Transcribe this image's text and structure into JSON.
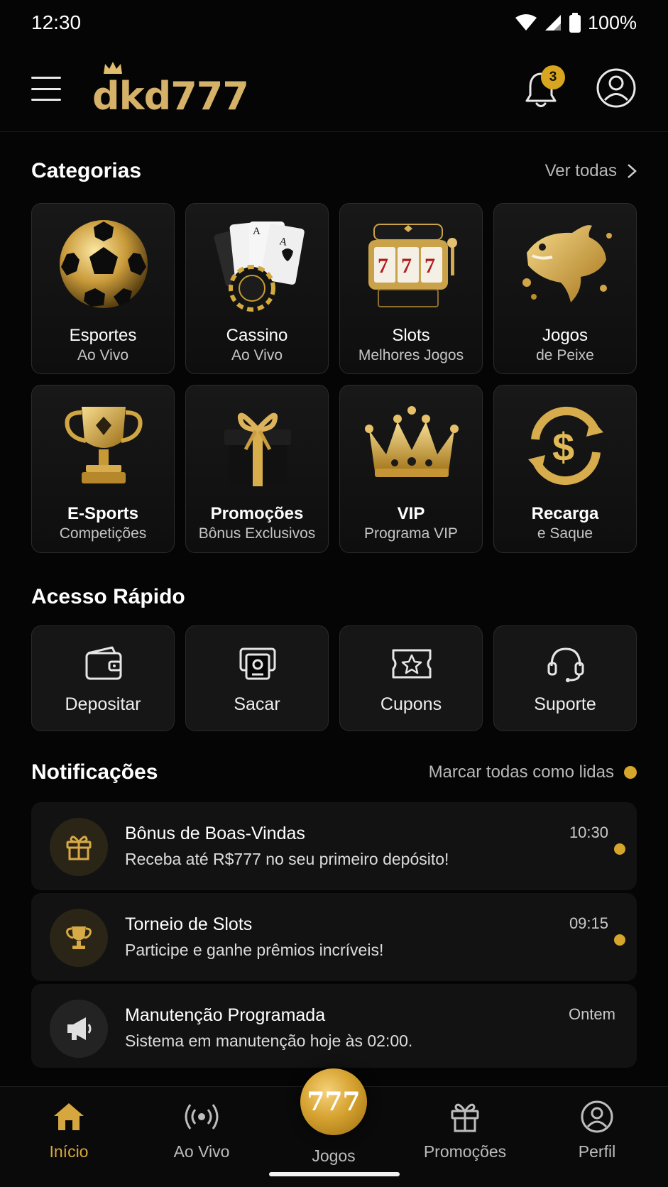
{
  "status_bar": {
    "time": "12:30",
    "battery": "100%"
  },
  "header": {
    "logo": "dkd777",
    "notification_count": "3"
  },
  "categories": {
    "title": "Categorias",
    "action": "Ver todas",
    "items": [
      {
        "title": "Esportes",
        "subtitle": "Ao Vivo",
        "icon": "soccer-ball-icon"
      },
      {
        "title": "Cassino",
        "subtitle": "Ao Vivo",
        "icon": "playing-cards-icon"
      },
      {
        "title": "Slots",
        "subtitle": "Melhores Jogos",
        "icon": "slot-machine-icon"
      },
      {
        "title": "Jogos",
        "subtitle": "de Peixe",
        "icon": "golden-fish-icon"
      },
      {
        "title": "E-Sports",
        "subtitle": "Competições",
        "icon": "trophy-icon"
      },
      {
        "title": "Promoções",
        "subtitle": "Bônus Exclusivos",
        "icon": "gift-box-icon"
      },
      {
        "title": "VIP",
        "subtitle": "Programa VIP",
        "icon": "crown-icon"
      },
      {
        "title": "Recarga",
        "subtitle": "e Saque",
        "icon": "dollar-exchange-icon"
      }
    ]
  },
  "quick_access": {
    "title": "Acesso Rápido",
    "items": [
      {
        "label": "Depositar",
        "icon": "wallet-icon"
      },
      {
        "label": "Sacar",
        "icon": "cash-withdraw-icon"
      },
      {
        "label": "Cupons",
        "icon": "coupon-icon"
      },
      {
        "label": "Suporte",
        "icon": "headset-icon"
      }
    ]
  },
  "notifications": {
    "title": "Notificações",
    "action": "Marcar todas como lidas",
    "items": [
      {
        "title": "Bônus de Boas-Vindas",
        "message": "Receba até R$777 no seu primeiro depósito!",
        "time": "10:30",
        "icon": "gift-icon",
        "unread": true
      },
      {
        "title": "Torneio de Slots",
        "message": "Participe e ganhe prêmios incríveis!",
        "time": "09:15",
        "icon": "trophy-icon",
        "unread": true
      },
      {
        "title": "Manutenção Programada",
        "message": "Sistema em manutenção hoje às 02:00.",
        "time": "Ontem",
        "icon": "megaphone-icon",
        "unread": false
      }
    ]
  },
  "bottom_nav": {
    "items": [
      {
        "label": "Início",
        "icon": "home-icon",
        "active": true
      },
      {
        "label": "Ao Vivo",
        "icon": "live-broadcast-icon",
        "active": false
      },
      {
        "label": "Jogos",
        "icon": "777-coin-icon",
        "active": false
      },
      {
        "label": "Promoções",
        "icon": "gift-icon",
        "active": false
      },
      {
        "label": "Perfil",
        "icon": "user-icon",
        "active": false
      }
    ],
    "center_badge": "777"
  },
  "colors": {
    "accent_gold": "#d8a521",
    "background": "#050505",
    "card": "#161616"
  }
}
